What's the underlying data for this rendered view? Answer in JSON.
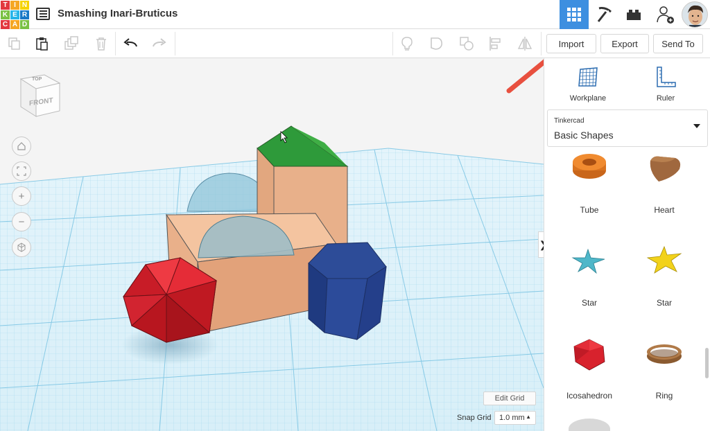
{
  "app": {
    "logo_letters": [
      "T",
      "I",
      "N",
      "K",
      "E",
      "R",
      "C",
      "A",
      "D"
    ],
    "logo_colors": [
      "#e2383f",
      "#f5a623",
      "#f5d300",
      "#7ac143",
      "#26b5e8",
      "#1a79c7",
      "#e2383f",
      "#f5a623",
      "#7ac143"
    ],
    "document_title": "Smashing Inari-Bruticus"
  },
  "header_tabs": [
    {
      "name": "3d-design",
      "icon": "grid-icon",
      "active": true
    },
    {
      "name": "minecraft",
      "icon": "pickaxe-icon",
      "active": false
    },
    {
      "name": "lego",
      "icon": "brick-icon",
      "active": false
    },
    {
      "name": "add-user",
      "icon": "add-user-icon",
      "active": false
    }
  ],
  "toolbar": {
    "left_tools": [
      "copy-icon",
      "paste-icon",
      "duplicate-icon",
      "delete-icon",
      "undo-icon",
      "redo-icon"
    ],
    "right_tools": [
      "lightbulb-icon",
      "group-icon",
      "ungroup-icon",
      "align-icon",
      "mirror-icon"
    ],
    "import_label": "Import",
    "export_label": "Export",
    "send_to_label": "Send To"
  },
  "viewcube": {
    "top_label": "TOP",
    "front_label": "FRONT"
  },
  "view_controls": [
    "home-icon",
    "fit-icon",
    "zoom-in-icon",
    "zoom-out-icon",
    "perspective-icon"
  ],
  "grid_controls": {
    "edit_grid_label": "Edit Grid",
    "snap_grid_label": "Snap Grid",
    "snap_value": "1.0 mm"
  },
  "panel": {
    "workplane_label": "Workplane",
    "ruler_label": "Ruler",
    "library_category": "Tinkercad",
    "library_name": "Basic Shapes",
    "shapes": [
      {
        "label": "Tube",
        "color": "#e07c26"
      },
      {
        "label": "Heart",
        "color": "#a0683e"
      },
      {
        "label": "Star",
        "color": "#4fb7c9"
      },
      {
        "label": "Star",
        "color": "#f2d21b"
      },
      {
        "label": "Icosahedron",
        "color": "#d8222d"
      },
      {
        "label": "Ring",
        "color": "#9c6b3e"
      }
    ]
  },
  "colors": {
    "accent": "#3d8fe0",
    "grid": "#8fd0ea",
    "annotation_arrow": "#e8503f"
  }
}
